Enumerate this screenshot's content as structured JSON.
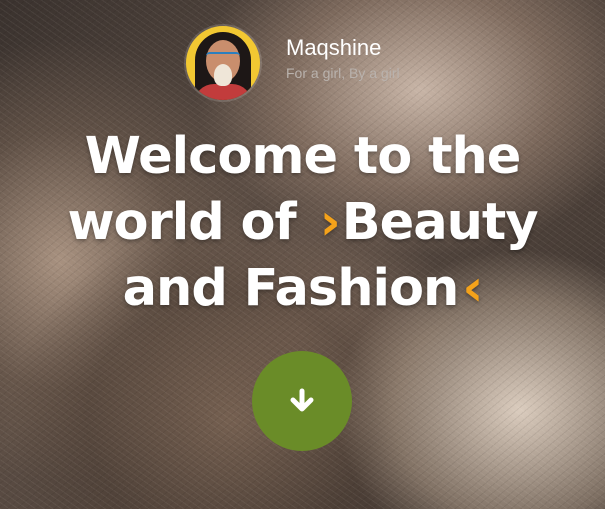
{
  "site": {
    "title": "Maqshine",
    "tagline": "For a girl, By a girl"
  },
  "hero": {
    "line1": "Welcome to the",
    "line2_prefix": "world of",
    "accent_open": "›",
    "line2_highlight": "Beauty",
    "line3": "and Fashion",
    "accent_close": "‹"
  },
  "scroll_button": {
    "icon": "arrow-down-icon"
  },
  "colors": {
    "accent": "#f4a21a",
    "button": "#6a8c28",
    "text": "#ffffff",
    "tagline": "#b9b2ad"
  }
}
